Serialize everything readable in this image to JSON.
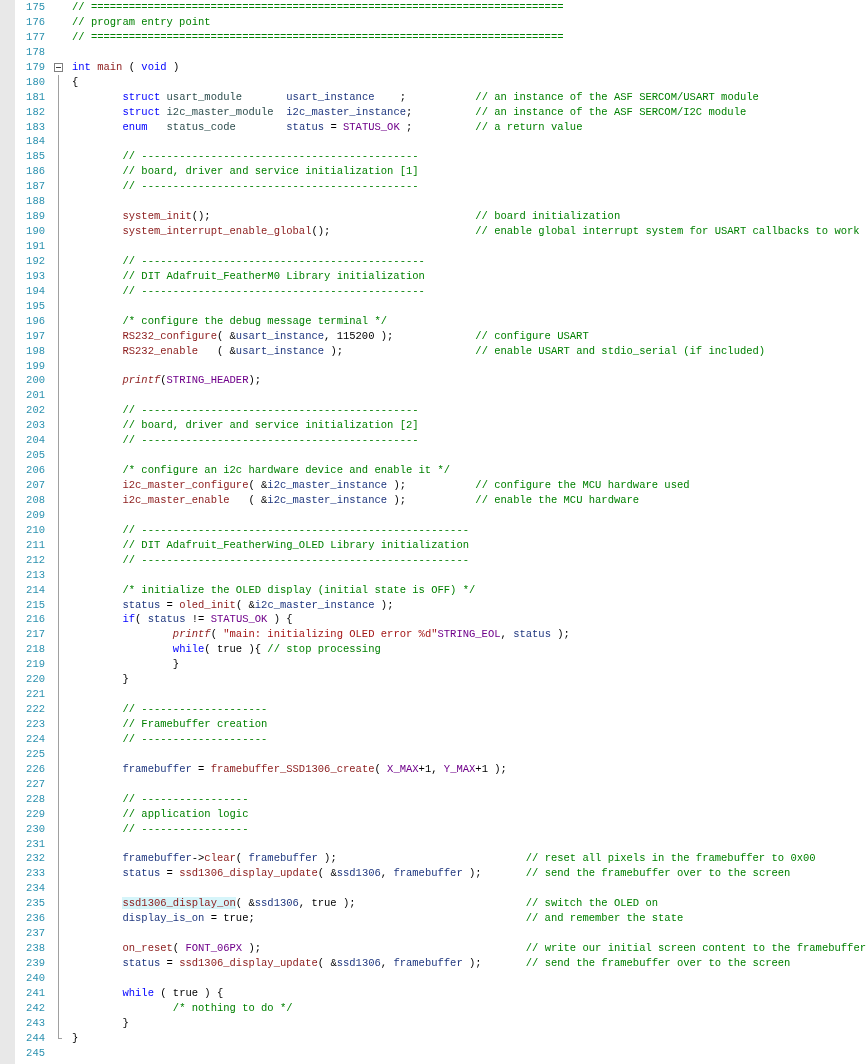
{
  "lines": [
    {
      "number": "175",
      "tokens": [
        {
          "kind": "comment",
          "text": "// ==========================================================================="
        }
      ]
    },
    {
      "number": "176",
      "tokens": [
        {
          "kind": "comment",
          "text": "// program entry point"
        }
      ]
    },
    {
      "number": "177",
      "tokens": [
        {
          "kind": "comment",
          "text": "// ==========================================================================="
        }
      ]
    },
    {
      "number": "178"
    },
    {
      "number": "179",
      "expanded": true,
      "tokens": [
        {
          "kind": "keyword",
          "text": "int "
        },
        {
          "kind": "function",
          "text": "main"
        },
        {
          "kind": "plain",
          "text": " ( "
        },
        {
          "kind": "keyword",
          "text": "void"
        },
        {
          "kind": "plain",
          "text": " )"
        }
      ],
      "children": [
        {
          "number": "180",
          "tokens": [
            {
              "kind": "plain",
              "text": "{"
            }
          ]
        },
        {
          "number": "181",
          "tokens": [
            {
              "kind": "keyword",
              "text": "        struct"
            },
            {
              "kind": "type",
              "text": " usart_module       "
            },
            {
              "kind": "variable",
              "text": "usart_instance"
            },
            {
              "kind": "plain",
              "text": "    ;           "
            },
            {
              "kind": "comment",
              "text": "// an instance of the ASF SERCOM/USART module"
            }
          ]
        },
        {
          "number": "182",
          "tokens": [
            {
              "kind": "keyword",
              "text": "        struct"
            },
            {
              "kind": "type",
              "text": " i2c_master_module  "
            },
            {
              "kind": "variable",
              "text": "i2c_master_instance"
            },
            {
              "kind": "plain",
              "text": ";          "
            },
            {
              "kind": "comment",
              "text": "// an instance of the ASF SERCOM/I2C module"
            }
          ]
        },
        {
          "number": "183",
          "tokens": [
            {
              "kind": "keyword",
              "text": "        enum"
            },
            {
              "kind": "type",
              "text": "   status_code        "
            },
            {
              "kind": "variable",
              "text": "status"
            },
            {
              "kind": "plain",
              "text": " = "
            },
            {
              "kind": "macro",
              "text": "STATUS_OK"
            },
            {
              "kind": "plain",
              "text": " ;          "
            },
            {
              "kind": "comment",
              "text": "// a return value"
            }
          ]
        },
        {
          "number": "184"
        },
        {
          "number": "185",
          "tokens": [
            {
              "kind": "comment",
              "text": "        // --------------------------------------------"
            }
          ]
        },
        {
          "number": "186",
          "tokens": [
            {
              "kind": "comment",
              "text": "        // board, driver and service initialization [1]"
            }
          ]
        },
        {
          "number": "187",
          "tokens": [
            {
              "kind": "comment",
              "text": "        // --------------------------------------------"
            }
          ]
        },
        {
          "number": "188"
        },
        {
          "number": "189",
          "tokens": [
            {
              "kind": "function",
              "text": "        system_init"
            },
            {
              "kind": "plain",
              "text": "();                                          "
            },
            {
              "kind": "comment",
              "text": "// board initialization"
            }
          ]
        },
        {
          "number": "190",
          "tokens": [
            {
              "kind": "function",
              "text": "        system_interrupt_enable_global"
            },
            {
              "kind": "plain",
              "text": "();                       "
            },
            {
              "kind": "comment",
              "text": "// enable global interrupt system for USART callbacks to work"
            }
          ]
        },
        {
          "number": "191"
        },
        {
          "number": "192",
          "tokens": [
            {
              "kind": "comment",
              "text": "        // ---------------------------------------------"
            }
          ]
        },
        {
          "number": "193",
          "tokens": [
            {
              "kind": "comment",
              "text": "        // DIT Adafruit_FeatherM0 Library initialization"
            }
          ]
        },
        {
          "number": "194",
          "tokens": [
            {
              "kind": "comment",
              "text": "        // ---------------------------------------------"
            }
          ]
        },
        {
          "number": "195"
        },
        {
          "number": "196",
          "tokens": [
            {
              "kind": "comment",
              "text": "        /* configure the debug message terminal */"
            }
          ]
        },
        {
          "number": "197",
          "tokens": [
            {
              "kind": "function",
              "text": "        RS232_configure"
            },
            {
              "kind": "plain",
              "text": "( &"
            },
            {
              "kind": "variable",
              "text": "usart_instance"
            },
            {
              "kind": "plain",
              "text": ", 115200 );             "
            },
            {
              "kind": "comment",
              "text": "// configure USART"
            }
          ]
        },
        {
          "number": "198",
          "tokens": [
            {
              "kind": "function",
              "text": "        RS232_enable"
            },
            {
              "kind": "plain",
              "text": "   ( &"
            },
            {
              "kind": "variable",
              "text": "usart_instance"
            },
            {
              "kind": "plain",
              "text": " );                     "
            },
            {
              "kind": "comment",
              "text": "// enable USART and stdio_serial (if included)"
            }
          ]
        },
        {
          "number": "199"
        },
        {
          "number": "200",
          "tokens": [
            {
              "kind": "library",
              "text": "        printf"
            },
            {
              "kind": "plain",
              "text": "("
            },
            {
              "kind": "macro",
              "text": "STRING_HEADER"
            },
            {
              "kind": "plain",
              "text": ");"
            }
          ]
        },
        {
          "number": "201"
        },
        {
          "number": "202",
          "tokens": [
            {
              "kind": "comment",
              "text": "        // --------------------------------------------"
            }
          ]
        },
        {
          "number": "203",
          "tokens": [
            {
              "kind": "comment",
              "text": "        // board, driver and service initialization [2]"
            }
          ]
        },
        {
          "number": "204",
          "tokens": [
            {
              "kind": "comment",
              "text": "        // --------------------------------------------"
            }
          ]
        },
        {
          "number": "205"
        },
        {
          "number": "206",
          "tokens": [
            {
              "kind": "comment",
              "text": "        /* configure an i2c hardware device and enable it */"
            }
          ]
        },
        {
          "number": "207",
          "tokens": [
            {
              "kind": "function",
              "text": "        i2c_master_configure"
            },
            {
              "kind": "plain",
              "text": "( &"
            },
            {
              "kind": "variable",
              "text": "i2c_master_instance"
            },
            {
              "kind": "plain",
              "text": " );           "
            },
            {
              "kind": "comment",
              "text": "// configure the MCU hardware used"
            }
          ]
        },
        {
          "number": "208",
          "tokens": [
            {
              "kind": "function",
              "text": "        i2c_master_enable"
            },
            {
              "kind": "plain",
              "text": "   ( &"
            },
            {
              "kind": "variable",
              "text": "i2c_master_instance"
            },
            {
              "kind": "plain",
              "text": " );           "
            },
            {
              "kind": "comment",
              "text": "// enable the MCU hardware"
            }
          ]
        },
        {
          "number": "209"
        },
        {
          "number": "210",
          "tokens": [
            {
              "kind": "comment",
              "text": "        // ----------------------------------------------------"
            }
          ]
        },
        {
          "number": "211",
          "tokens": [
            {
              "kind": "comment",
              "text": "        // DIT Adafruit_FeatherWing_OLED Library initialization"
            }
          ]
        },
        {
          "number": "212",
          "tokens": [
            {
              "kind": "comment",
              "text": "        // ----------------------------------------------------"
            }
          ]
        },
        {
          "number": "213"
        },
        {
          "number": "214",
          "tokens": [
            {
              "kind": "comment",
              "text": "        /* initialize the OLED display (initial state is OFF) */"
            }
          ]
        },
        {
          "number": "215",
          "tokens": [
            {
              "kind": "variable",
              "text": "        status"
            },
            {
              "kind": "plain",
              "text": " = "
            },
            {
              "kind": "function",
              "text": "oled_init"
            },
            {
              "kind": "plain",
              "text": "( &"
            },
            {
              "kind": "variable",
              "text": "i2c_master_instance"
            },
            {
              "kind": "plain",
              "text": " );"
            }
          ]
        },
        {
          "number": "216",
          "tokens": [
            {
              "kind": "keyword",
              "text": "        if"
            },
            {
              "kind": "plain",
              "text": "( "
            },
            {
              "kind": "variable",
              "text": "status"
            },
            {
              "kind": "plain",
              "text": " != "
            },
            {
              "kind": "macro",
              "text": "STATUS_OK"
            },
            {
              "kind": "plain",
              "text": " ) {"
            }
          ]
        },
        {
          "number": "217",
          "tokens": [
            {
              "kind": "library",
              "text": "                printf"
            },
            {
              "kind": "plain",
              "text": "( "
            },
            {
              "kind": "string",
              "text": "\"main: initializing OLED error %d\""
            },
            {
              "kind": "macro",
              "text": "STRING_EOL"
            },
            {
              "kind": "plain",
              "text": ", "
            },
            {
              "kind": "variable",
              "text": "status"
            },
            {
              "kind": "plain",
              "text": " );"
            }
          ]
        },
        {
          "number": "218",
          "tokens": [
            {
              "kind": "keyword",
              "text": "                while"
            },
            {
              "kind": "plain",
              "text": "( true ){ "
            },
            {
              "kind": "comment",
              "text": "// stop processing"
            }
          ]
        },
        {
          "number": "219",
          "tokens": [
            {
              "kind": "plain",
              "text": "                }"
            }
          ]
        },
        {
          "number": "220",
          "tokens": [
            {
              "kind": "plain",
              "text": "        }"
            }
          ]
        },
        {
          "number": "221"
        },
        {
          "number": "222",
          "tokens": [
            {
              "kind": "comment",
              "text": "        // --------------------"
            }
          ]
        },
        {
          "number": "223",
          "tokens": [
            {
              "kind": "comment",
              "text": "        // Framebuffer creation"
            }
          ]
        },
        {
          "number": "224",
          "tokens": [
            {
              "kind": "comment",
              "text": "        // --------------------"
            }
          ]
        },
        {
          "number": "225"
        },
        {
          "number": "226",
          "tokens": [
            {
              "kind": "variable",
              "text": "        framebuffer"
            },
            {
              "kind": "plain",
              "text": " = "
            },
            {
              "kind": "function",
              "text": "framebuffer_SSD1306_create"
            },
            {
              "kind": "plain",
              "text": "( "
            },
            {
              "kind": "macro",
              "text": "X_MAX"
            },
            {
              "kind": "plain",
              "text": "+1, "
            },
            {
              "kind": "macro",
              "text": "Y_MAX"
            },
            {
              "kind": "plain",
              "text": "+1 );"
            }
          ]
        },
        {
          "number": "227"
        },
        {
          "number": "228",
          "tokens": [
            {
              "kind": "comment",
              "text": "        // -----------------"
            }
          ]
        },
        {
          "number": "229",
          "tokens": [
            {
              "kind": "comment",
              "text": "        // application logic"
            }
          ]
        },
        {
          "number": "230",
          "tokens": [
            {
              "kind": "comment",
              "text": "        // -----------------"
            }
          ]
        },
        {
          "number": "231"
        },
        {
          "number": "232",
          "tokens": [
            {
              "kind": "variable",
              "text": "        framebuffer"
            },
            {
              "kind": "plain",
              "text": "->"
            },
            {
              "kind": "function",
              "text": "clear"
            },
            {
              "kind": "plain",
              "text": "( "
            },
            {
              "kind": "variable",
              "text": "framebuffer"
            },
            {
              "kind": "plain",
              "text": " );                              "
            },
            {
              "kind": "comment",
              "text": "// reset all pixels in the framebuffer to 0x00"
            }
          ]
        },
        {
          "number": "233",
          "tokens": [
            {
              "kind": "variable",
              "text": "        status"
            },
            {
              "kind": "plain",
              "text": " = "
            },
            {
              "kind": "function",
              "text": "ssd1306_display_update"
            },
            {
              "kind": "plain",
              "text": "( &"
            },
            {
              "kind": "variable",
              "text": "ssd1306"
            },
            {
              "kind": "plain",
              "text": ", "
            },
            {
              "kind": "variable",
              "text": "framebuffer"
            },
            {
              "kind": "plain",
              "text": " );       "
            },
            {
              "kind": "comment",
              "text": "// send the framebuffer over to the screen"
            }
          ]
        },
        {
          "number": "234"
        },
        {
          "number": "235",
          "tokens": [
            {
              "kind": "match",
              "text": "        ssd1306_display_on"
            },
            {
              "kind": "plain",
              "text": "( &"
            },
            {
              "kind": "variable",
              "text": "ssd1306"
            },
            {
              "kind": "plain",
              "text": ", true );                           "
            },
            {
              "kind": "comment",
              "text": "// switch the OLED on"
            }
          ]
        },
        {
          "number": "236",
          "tokens": [
            {
              "kind": "variable",
              "text": "        display_is_on"
            },
            {
              "kind": "plain",
              "text": " = true;                                           "
            },
            {
              "kind": "comment",
              "text": "// and remember the state"
            }
          ]
        },
        {
          "number": "237"
        },
        {
          "number": "238",
          "tokens": [
            {
              "kind": "function",
              "text": "        on_reset"
            },
            {
              "kind": "plain",
              "text": "( "
            },
            {
              "kind": "macro",
              "text": "FONT_06PX"
            },
            {
              "kind": "plain",
              "text": " );                                          "
            },
            {
              "kind": "comment",
              "text": "// write our initial screen content to the framebuffer"
            }
          ]
        },
        {
          "number": "239",
          "tokens": [
            {
              "kind": "variable",
              "text": "        status"
            },
            {
              "kind": "plain",
              "text": " = "
            },
            {
              "kind": "function",
              "text": "ssd1306_display_update"
            },
            {
              "kind": "plain",
              "text": "( &"
            },
            {
              "kind": "variable",
              "text": "ssd1306"
            },
            {
              "kind": "plain",
              "text": ", "
            },
            {
              "kind": "variable",
              "text": "framebuffer"
            },
            {
              "kind": "plain",
              "text": " );       "
            },
            {
              "kind": "comment",
              "text": "// send the framebuffer over to the screen"
            }
          ]
        },
        {
          "number": "240"
        },
        {
          "number": "241",
          "tokens": [
            {
              "kind": "keyword",
              "text": "        while"
            },
            {
              "kind": "plain",
              "text": " ( true ) {"
            }
          ]
        },
        {
          "number": "242",
          "tokens": [
            {
              "kind": "comment",
              "text": "                /* nothing to do */"
            }
          ]
        },
        {
          "number": "243",
          "tokens": [
            {
              "kind": "plain",
              "text": "        }"
            }
          ]
        },
        {
          "number": "244",
          "tokens": [
            {
              "kind": "plain",
              "text": "}"
            }
          ]
        }
      ]
    },
    {
      "number": "245"
    }
  ]
}
